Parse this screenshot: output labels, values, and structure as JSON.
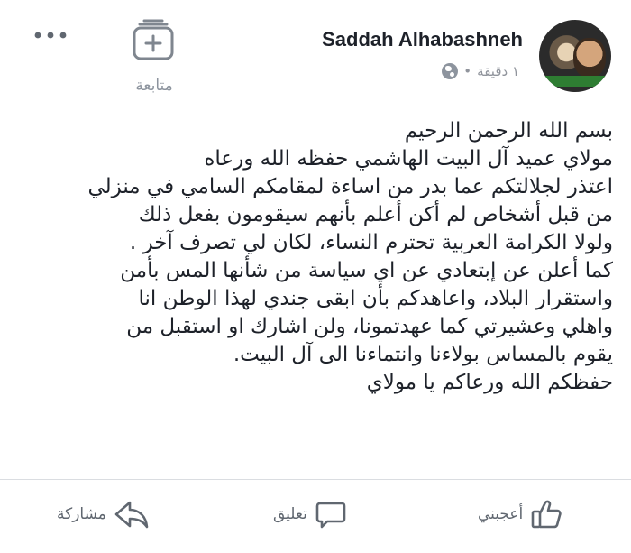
{
  "post": {
    "author": "Saddah Alhabashneh",
    "time": "١ دقيقة",
    "separator": "•",
    "privacy_icon": "globe-icon",
    "follow_label": "متابعة",
    "more_icon": "more-horizontal-icon",
    "lines": [
      "بسم الله الرحمن الرحيم",
      "مولاي عميد آل البيت الهاشمي حفظه الله ورعاه",
      "اعتذر لجلالتكم عما بدر من اساءة لمقامكم السامي في منزلي",
      "من قبل أشخاص لم أكن أعلم  بأنهم سيقومون بفعل ذلك",
      "ولولا الكرامة العربية تحترم النساء، لكان لي تصرف آخر .",
      "كما أعلن عن إبتعادي عن اي سياسة من شأنها المس بأمن",
      "واستقرار البلاد،  واعاهدكم بأن ابقى جندي لهذا الوطن انا",
      "واهلي وعشيرتي كما عهدتمونا، ولن اشارك او استقبل من",
      "يقوم بالمساس بولاءنا وانتماءنا الى آل البيت.",
      "حفظكم الله ورعاكم يا مولاي"
    ]
  },
  "actions": {
    "like_label": "أعجبني",
    "comment_label": "تعليق",
    "share_label": "مشاركة"
  }
}
